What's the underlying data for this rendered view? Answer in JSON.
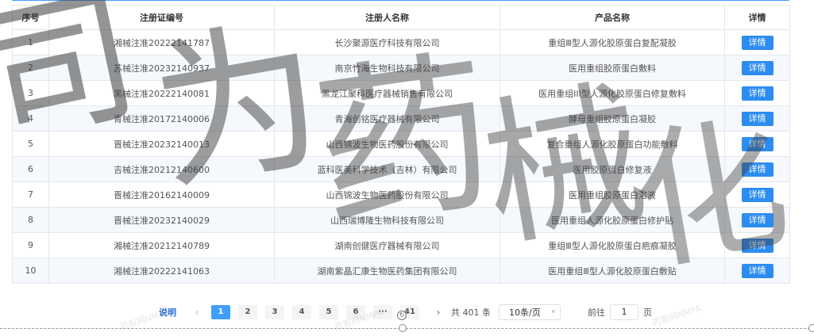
{
  "table": {
    "headers": [
      "序号",
      "注册证编号",
      "注册人名称",
      "产品名称",
      "详情"
    ],
    "detail_label": "详情",
    "rows": [
      {
        "no": "1",
        "cert": "湘械注准20222141787",
        "registrant": "长沙聚源医疗科技有限公司",
        "product": "重组Ⅲ型人源化胶原蛋白复配凝胶"
      },
      {
        "no": "2",
        "cert": "苏械注准20232140937",
        "registrant": "南京竹海生物科技有限公司",
        "product": "医用重组胶原蛋白敷料"
      },
      {
        "no": "3",
        "cert": "黑械注准20222140081",
        "registrant": "黑龙江聚科医疗器械销售有限公司",
        "product": "医用重组III型人源化胶原蛋白修复敷料"
      },
      {
        "no": "4",
        "cert": "青械注准20172140006",
        "registrant": "青海创铭医疗器械有限公司",
        "product": "酵母重组胶原蛋白凝胶"
      },
      {
        "no": "5",
        "cert": "晋械注准20232140013",
        "registrant": "山西锦波生物医药股份有限公司",
        "product": "复合重组人源化胶原蛋白功能敷料"
      },
      {
        "no": "6",
        "cert": "吉械注准20212140600",
        "registrant": "蓝科医美科学技术（吉林）有限公司",
        "product": "医用胶原蛋白修复液"
      },
      {
        "no": "7",
        "cert": "晋械注准20162140009",
        "registrant": "山西锦波生物医药股份有限公司",
        "product": "医用重组胶原蛋白溶液"
      },
      {
        "no": "8",
        "cert": "晋械注准20232140029",
        "registrant": "山西瑞博隆生物科技有限公司",
        "product": "医用重组人源化胶原蛋白修护贴"
      },
      {
        "no": "9",
        "cert": "湘械注准20212140789",
        "registrant": "湖南创健医疗器械有限公司",
        "product": "重组Ⅲ型人源化胶原蛋白疤痕凝胶"
      },
      {
        "no": "10",
        "cert": "湘械注准20222141063",
        "registrant": "湖南紫晶汇康生物医药集团有限公司",
        "product": "医用重组Ⅲ型人源化胶原蛋白敷贴"
      }
    ]
  },
  "pagination": {
    "explain": "说明",
    "prev": "‹",
    "pages": [
      "1",
      "2",
      "3",
      "4",
      "5",
      "6",
      "···",
      "41"
    ],
    "active_page": "1",
    "next": "›",
    "total": "共 401 条",
    "page_size": "10条/页",
    "goto_label": "前往",
    "goto_value": "1",
    "page_unit": "页"
  },
  "watermark": {
    "chars": [
      "司",
      "为",
      "药",
      "械",
      "化"
    ],
    "small_text": "药智网NMPA"
  },
  "colors": {
    "accent": "#409eff",
    "detail_button": "#2d8cf0",
    "row_stripe": "#f5f8fc"
  }
}
